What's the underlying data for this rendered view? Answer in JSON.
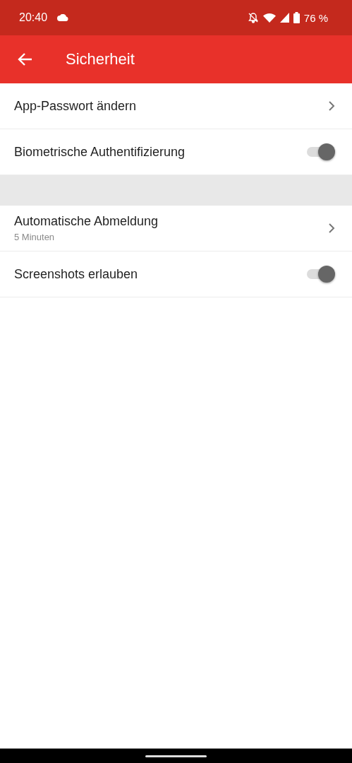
{
  "status_bar": {
    "time": "20:40",
    "battery": "76 %"
  },
  "app_bar": {
    "title": "Sicherheit"
  },
  "sections": [
    {
      "items": [
        {
          "kind": "link",
          "label": "App-Passwort ändern"
        },
        {
          "kind": "toggle",
          "label": "Biometrische Authentifizierung",
          "on": true,
          "disabled": true
        }
      ]
    },
    {
      "items": [
        {
          "kind": "link",
          "label": "Automatische Abmeldung",
          "summary": "5 Minuten"
        },
        {
          "kind": "toggle",
          "label": "Screenshots erlauben",
          "on": true,
          "disabled": true
        }
      ]
    }
  ]
}
